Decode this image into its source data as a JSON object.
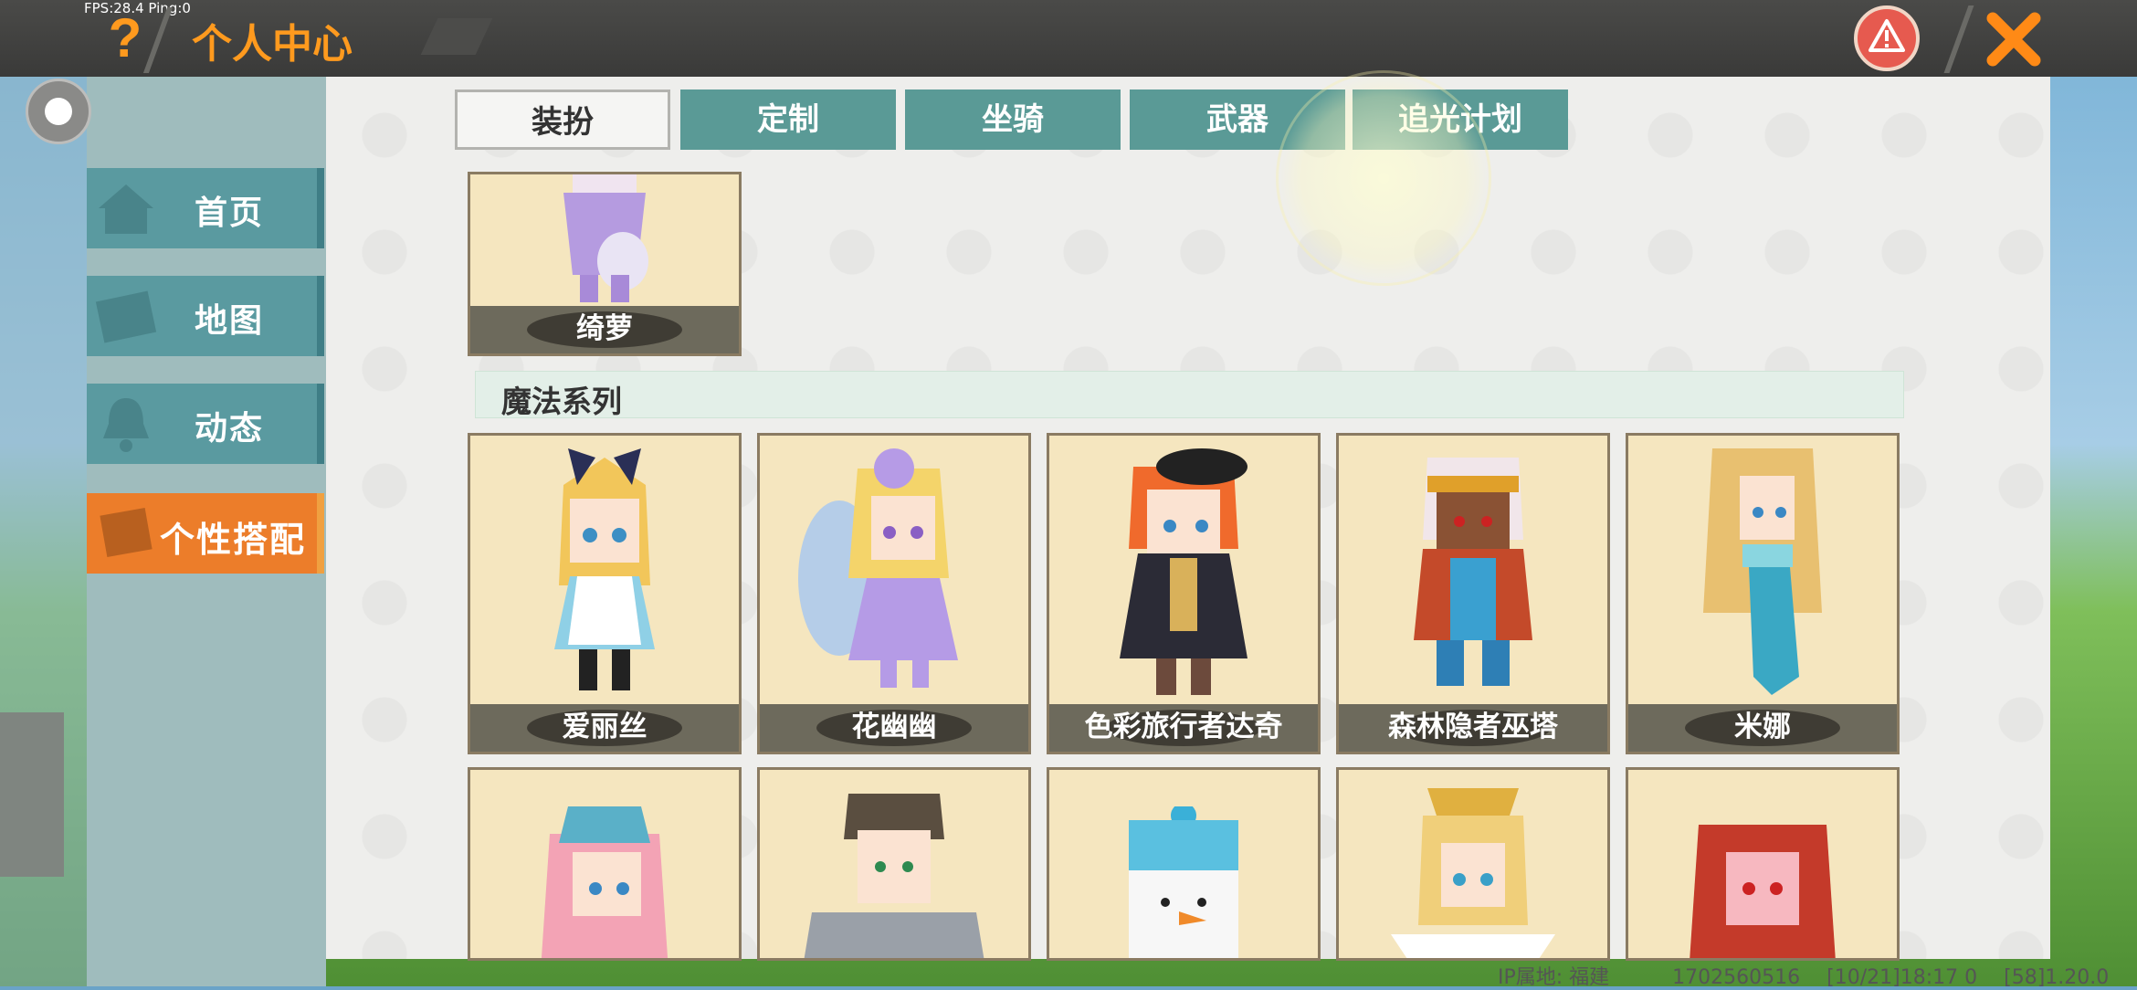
{
  "status": {
    "fps": "FPS:28.4  Ping:0"
  },
  "header": {
    "title": "个人中心"
  },
  "sidebar": {
    "items": [
      {
        "label": "首页"
      },
      {
        "label": "地图"
      },
      {
        "label": "动态"
      },
      {
        "label": "个性搭配",
        "active": true
      }
    ]
  },
  "tabs": [
    {
      "label": "装扮",
      "active": true
    },
    {
      "label": "定制"
    },
    {
      "label": "坐骑"
    },
    {
      "label": "武器"
    },
    {
      "label": "追光计划"
    }
  ],
  "top_card": {
    "name": "绮萝"
  },
  "section": {
    "title": "魔法系列"
  },
  "cards_row1": [
    {
      "name": "爱丽丝"
    },
    {
      "name": "花幽幽"
    },
    {
      "name": "色彩旅行者达奇"
    },
    {
      "name": "森林隐者巫塔"
    },
    {
      "name": "米娜"
    }
  ],
  "footer": {
    "ip": "IP属地: 福建",
    "uid": "1702560516",
    "time": "[10/21]18:17 0",
    "version": "[58]1.20.0"
  },
  "colors": {
    "accent": "#ff9a1e",
    "tab": "#5a9a96",
    "active_nav": "#ec7d2a",
    "warning": "#e65a4f"
  }
}
